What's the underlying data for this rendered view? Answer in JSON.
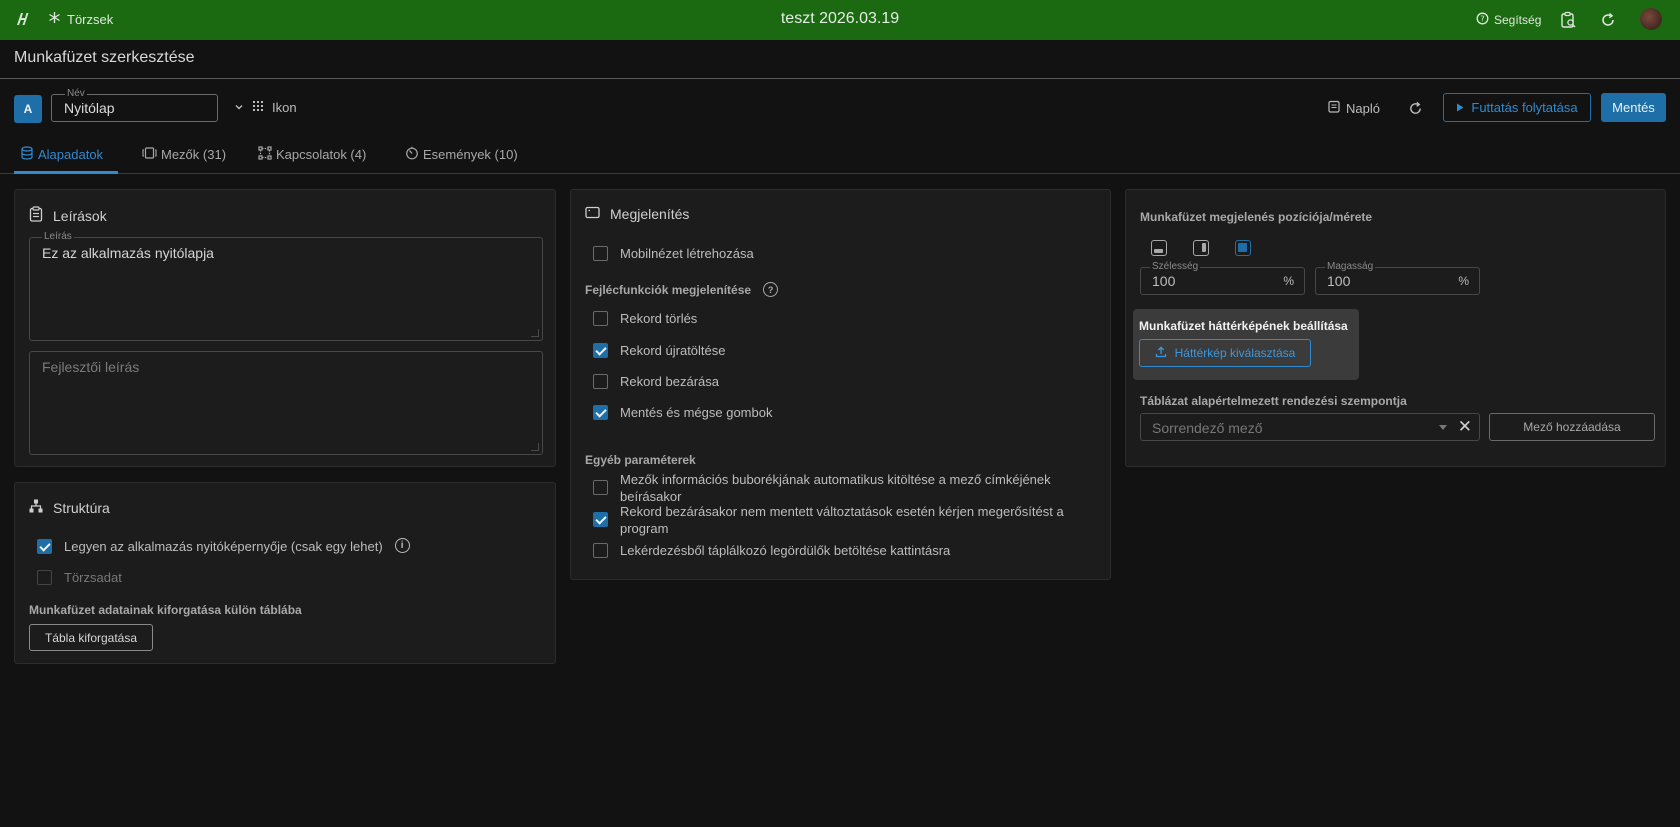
{
  "topbar": {
    "nav_label": "Törzsek",
    "app_title": "teszt 2026.03.19",
    "help_label": "Segítség"
  },
  "page": {
    "title": "Munkafüzet szerkesztése"
  },
  "header": {
    "badge": "A",
    "name_label": "Név",
    "name_value": "Nyitólap",
    "icon_label": "Ikon",
    "naplo_label": "Napló",
    "run_label": "Futtatás folytatása",
    "save_label": "Mentés"
  },
  "tabs": [
    {
      "label": "Alapadatok",
      "active": true
    },
    {
      "label": "Mezők (31)",
      "active": false
    },
    {
      "label": "Kapcsolatok (4)",
      "active": false
    },
    {
      "label": "Események (10)",
      "active": false
    }
  ],
  "descriptions": {
    "title": "Leírások",
    "desc_label": "Leírás",
    "desc_value": "Ez az alkalmazás nyitólapja",
    "dev_placeholder": "Fejlesztői leírás"
  },
  "structure": {
    "title": "Struktúra",
    "start_screen": {
      "label": "Legyen az alkalmazás nyitóképernyője (csak egy lehet)",
      "checked": true
    },
    "master_data": {
      "label": "Törzsadat",
      "checked": false,
      "disabled": true
    },
    "export_heading": "Munkafüzet adatainak kiforgatása külön táblába",
    "export_button": "Tábla kiforgatása"
  },
  "display": {
    "title": "Megjelenítés",
    "mobile": {
      "label": "Mobilnézet létrehozása",
      "checked": false
    },
    "header_functions_heading": "Fejlécfunkciók megjelenítése",
    "header_functions": [
      {
        "label": "Rekord törlés",
        "checked": false
      },
      {
        "label": "Rekord újratöltése",
        "checked": true
      },
      {
        "label": "Rekord bezárása",
        "checked": false
      },
      {
        "label": "Mentés és mégse gombok",
        "checked": true
      }
    ],
    "other_heading": "Egyéb paraméterek",
    "other": [
      {
        "label": "Mezők információs buborékjának automatikus kitöltése a mező címkéjének beírásakor",
        "checked": false
      },
      {
        "label": "Rekord bezárásakor nem mentett változtatások esetén kérjen megerősítést a program",
        "checked": true
      },
      {
        "label": "Lekérdezésből táplálkozó legördülők betöltése kattintásra",
        "checked": false
      }
    ]
  },
  "position": {
    "heading": "Munkafüzet megjelenés pozíciója/mérete",
    "width_label": "Szélesség",
    "width_value": "100",
    "width_unit": "%",
    "height_label": "Magasság",
    "height_value": "100",
    "height_unit": "%",
    "background_heading": "Munkafüzet háttérképének beállítása",
    "background_button": "Háttérkép kiválasztása",
    "sort_heading": "Táblázat alapértelmezett rendezési szempontja",
    "sort_placeholder": "Sorrendező mező",
    "add_field_button": "Mező hozzáadása"
  },
  "colors": {
    "topbar": "#1b6a12",
    "accent": "#1e6fa8",
    "background": "#121212",
    "panel": "#1c1c1c"
  }
}
